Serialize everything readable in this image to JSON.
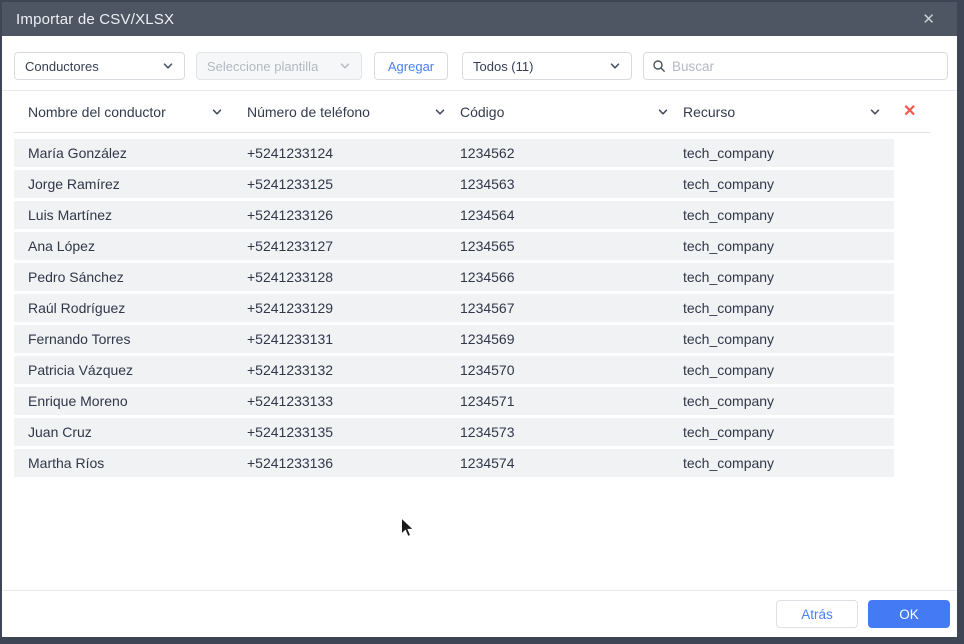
{
  "modal": {
    "title": "Importar de CSV/XLSX",
    "close_icon": "✕"
  },
  "toolbar": {
    "entity_select": {
      "value": "Conductores"
    },
    "template_select": {
      "placeholder": "Seleccione plantilla",
      "disabled": true
    },
    "add_button_label": "Agregar",
    "filter_select": {
      "value": "Todos (11)"
    },
    "search": {
      "placeholder": "Buscar"
    }
  },
  "table": {
    "columns": [
      "Nombre del conductor",
      "Número de teléfono",
      "Código",
      "Recurso"
    ],
    "remove_column_icon": "✕",
    "rows": [
      {
        "name": "María González",
        "phone": "+5241233124",
        "code": "1234562",
        "resource": "tech_company"
      },
      {
        "name": "Jorge Ramírez",
        "phone": "+5241233125",
        "code": "1234563",
        "resource": "tech_company"
      },
      {
        "name": "Luis Martínez",
        "phone": "+5241233126",
        "code": "1234564",
        "resource": "tech_company"
      },
      {
        "name": "Ana López",
        "phone": "+5241233127",
        "code": "1234565",
        "resource": "tech_company"
      },
      {
        "name": "Pedro Sánchez",
        "phone": "+5241233128",
        "code": "1234566",
        "resource": "tech_company"
      },
      {
        "name": "Raúl Rodríguez",
        "phone": "+5241233129",
        "code": "1234567",
        "resource": "tech_company"
      },
      {
        "name": "Fernando Torres",
        "phone": "+5241233131",
        "code": "1234569",
        "resource": "tech_company"
      },
      {
        "name": "Patricia Vázquez",
        "phone": "+5241233132",
        "code": "1234570",
        "resource": "tech_company"
      },
      {
        "name": "Enrique Moreno",
        "phone": "+5241233133",
        "code": "1234571",
        "resource": "tech_company"
      },
      {
        "name": "Juan Cruz",
        "phone": "+5241233135",
        "code": "1234573",
        "resource": "tech_company"
      },
      {
        "name": "Martha Ríos",
        "phone": "+5241233136",
        "code": "1234574",
        "resource": "tech_company"
      }
    ]
  },
  "footer": {
    "back_button_label": "Atrás",
    "ok_button_label": "OK"
  },
  "colors": {
    "titlebar": "#4e5663",
    "accent_blue": "#447bf4",
    "link_blue": "#4a80f5",
    "danger_red": "#f4584c",
    "row_background": "#f1f2f4",
    "backdrop": "#3e4655"
  }
}
